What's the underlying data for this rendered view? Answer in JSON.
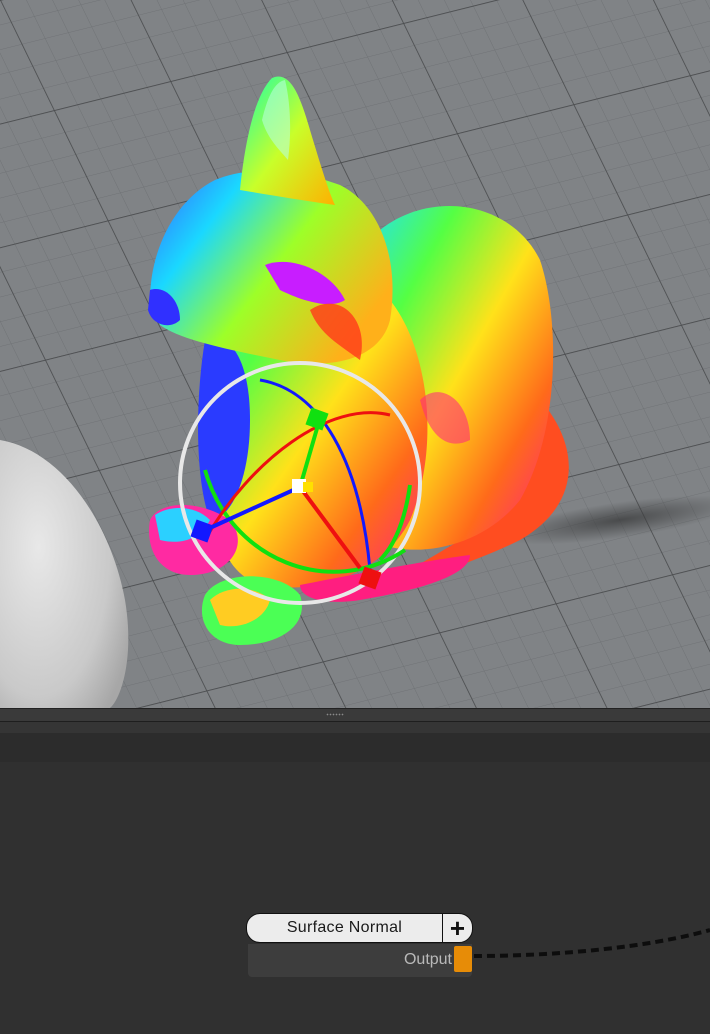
{
  "viewport": {
    "background": "#7d8083",
    "object": "cat-model-normal-shaded",
    "gizmo": "transform-gizmo"
  },
  "node_graph": {
    "node": {
      "title": "Surface Normal",
      "add_label": "+",
      "output_label": "Output",
      "port_color": "#e78c07"
    }
  }
}
